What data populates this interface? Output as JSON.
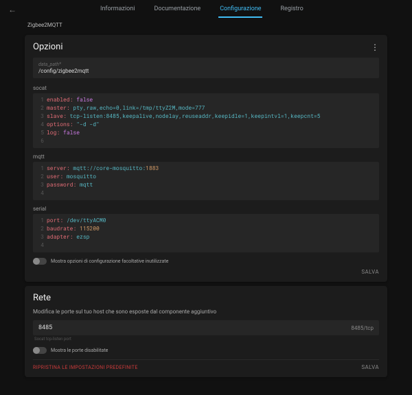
{
  "tabs": {
    "info": "Informazioni",
    "docs": "Documentazione",
    "config": "Configurazione",
    "log": "Registro"
  },
  "breadcrumb": "Zigbee2MQTT",
  "options": {
    "title": "Opzioni",
    "data_path_label": "data_path*",
    "data_path_value": "/config/zigbee2mqtt",
    "socat_label": "socat",
    "socat_lines": {
      "l1k": "enabled:",
      "l1v": "false",
      "l2k": "master:",
      "l2v": "pty,raw,echo=0,link=/tmp/ttyZ2M,mode=777",
      "l3k": "slave:",
      "l3v": "tcp-listen:8485,keepalive,nodelay,reuseaddr,keepidle=1,keepintvl=1,keepcnt=5",
      "l4k": "options:",
      "l4v": "\"-d -d\"",
      "l5k": "log:",
      "l5v": "false"
    },
    "mqtt_label": "mqtt",
    "mqtt_lines": {
      "l1k": "server:",
      "l1v1": "mqtt://core-mosquitto:",
      "l1v2": "1883",
      "l2k": "user:",
      "l2v": "mosquitto",
      "l3k": "password:",
      "l3v": "mqtt"
    },
    "serial_label": "serial",
    "serial_lines": {
      "l1k": "port:",
      "l1v": "/dev/ttyACM0",
      "l2k": "baudrate:",
      "l2v": "115200",
      "l3k": "adapter:",
      "l3v": "ezsp"
    },
    "unused_toggle": "Mostra opzioni di configurazione facoltative inutilizzate",
    "save": "SALVA"
  },
  "network": {
    "title": "Rete",
    "desc": "Modifica le porte sul tuo host che sono esposte dal componente aggiuntivo",
    "port_value": "8485",
    "port_label": "8485/tcp",
    "port_sub": "Socat tcp-listen port",
    "disabled_toggle": "Mostra le porte disabilitate",
    "reset": "RIPRISTINA LE IMPOSTAZIONI PREDEFINITE",
    "save": "SALVA"
  }
}
